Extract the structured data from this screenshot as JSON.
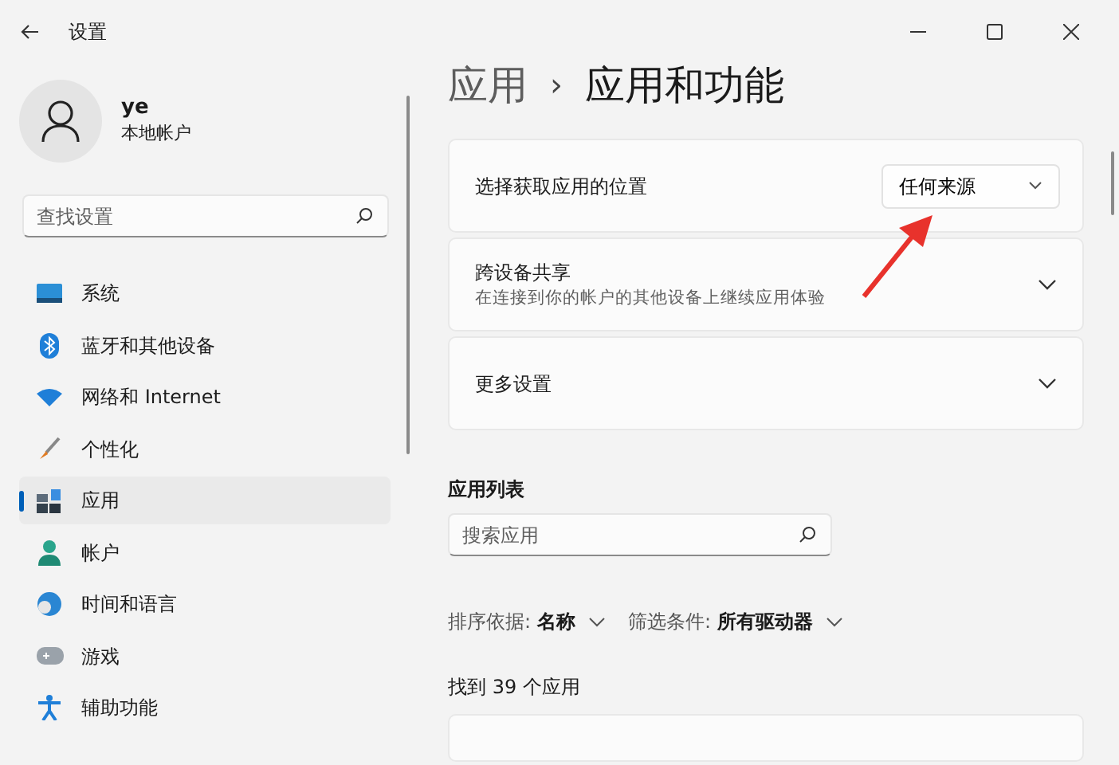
{
  "window": {
    "title": "设置"
  },
  "profile": {
    "name": "ye",
    "account": "本地帐户"
  },
  "sidebar": {
    "search": {
      "placeholder": "查找设置"
    },
    "items": [
      {
        "label": "系统",
        "selected": false
      },
      {
        "label": "蓝牙和其他设备",
        "selected": false
      },
      {
        "label": "网络和 Internet",
        "selected": false
      },
      {
        "label": "个性化",
        "selected": false
      },
      {
        "label": "应用",
        "selected": true
      },
      {
        "label": "帐户",
        "selected": false
      },
      {
        "label": "时间和语言",
        "selected": false
      },
      {
        "label": "游戏",
        "selected": false
      },
      {
        "label": "辅助功能",
        "selected": false
      }
    ]
  },
  "breadcrumb": {
    "parent": "应用",
    "separator": "›",
    "current": "应用和功能"
  },
  "settings": [
    {
      "kind": "dropdown",
      "title": "选择获取应用的位置",
      "value": "任何来源"
    },
    {
      "kind": "expander",
      "title": "跨设备共享",
      "description": "在连接到你的帐户的其他设备上继续应用体验",
      "expanded": false
    },
    {
      "kind": "expander",
      "title": "更多设置",
      "expanded": false
    }
  ],
  "app_list": {
    "heading": "应用列表",
    "search": {
      "placeholder": "搜索应用"
    },
    "sort": {
      "label": "排序依据:",
      "value": "名称"
    },
    "filter": {
      "label": "筛选条件:",
      "value": "所有驱动器"
    },
    "count": "找到 39 个应用"
  }
}
